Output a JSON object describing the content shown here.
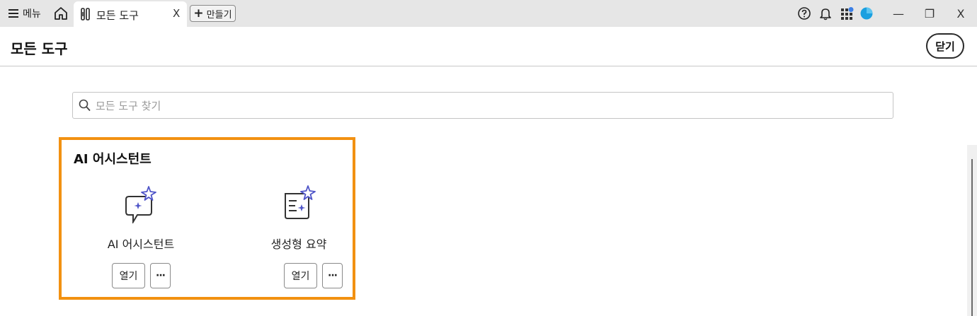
{
  "titlebar": {
    "menu_label": "메뉴",
    "tab_label": "모든 도구",
    "tab_close": "X",
    "create_label": "만들기",
    "create_plus": "+",
    "minimize": "—",
    "restore": "❐",
    "close": "X"
  },
  "header": {
    "title": "모든 도구",
    "close_label": "닫기"
  },
  "search": {
    "placeholder": "모든 도구 찾기",
    "value": ""
  },
  "category": {
    "title": "AI 어시스턴트",
    "tools": [
      {
        "label": "AI 어시스턴트",
        "open_label": "열기",
        "more_label": "···",
        "icon": "ai-assistant-icon"
      },
      {
        "label": "생성형 요약",
        "open_label": "열기",
        "more_label": "···",
        "icon": "generative-summary-icon"
      }
    ]
  },
  "colors": {
    "highlight": "#f29111",
    "accent": "#4f55c8",
    "avatar": "#1aa0e0",
    "badge": "#3b7fe6"
  }
}
